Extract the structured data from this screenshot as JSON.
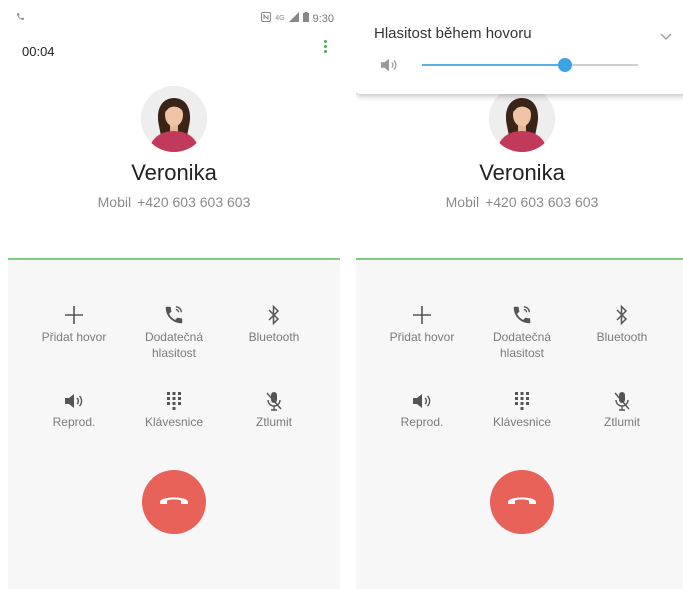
{
  "screens": [
    {
      "status": {
        "time": "9:30"
      },
      "timer": "00:04",
      "contact": {
        "name": "Veronika",
        "number_label": "Mobil",
        "number": "+420 603 603 603"
      },
      "actions": [
        {
          "label": "Přidat hovor",
          "icon": "plus-icon"
        },
        {
          "label": "Dodatečná hlasitost",
          "icon": "extra-volume-icon"
        },
        {
          "label": "Bluetooth",
          "icon": "bluetooth-icon"
        },
        {
          "label": "Reprod.",
          "icon": "speaker-icon"
        },
        {
          "label": "Klávesnice",
          "icon": "keypad-icon"
        },
        {
          "label": "Ztlumit",
          "icon": "mute-icon"
        }
      ]
    },
    {
      "contact": {
        "name": "Veronika",
        "number_label": "Mobil",
        "number": "+420 603 603 603"
      },
      "volume_panel": {
        "title": "Hlasitost během hovoru",
        "level": 0.66
      },
      "actions": [
        {
          "label": "Přidat hovor",
          "icon": "plus-icon"
        },
        {
          "label": "Dodatečná hlasitost",
          "icon": "extra-volume-icon"
        },
        {
          "label": "Bluetooth",
          "icon": "bluetooth-icon"
        },
        {
          "label": "Reprod.",
          "icon": "speaker-icon"
        },
        {
          "label": "Klávesnice",
          "icon": "keypad-icon"
        },
        {
          "label": "Ztlumit",
          "icon": "mute-icon"
        }
      ]
    }
  ],
  "colors": {
    "end_call": "#e9625a",
    "divider": "#7ccf7c",
    "slider": "#3aa3e3",
    "menu_dots": "#4caf50"
  }
}
